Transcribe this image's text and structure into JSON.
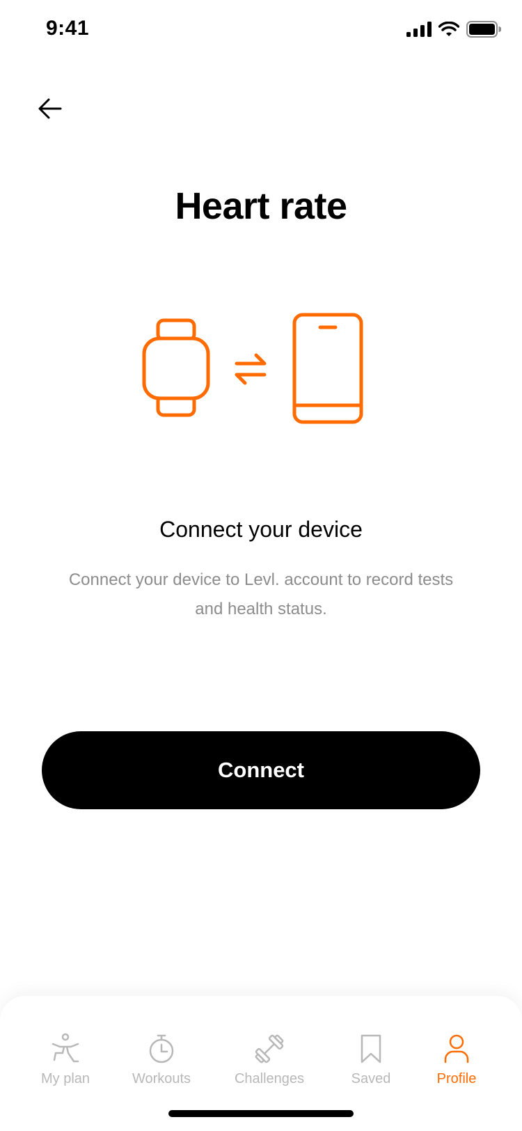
{
  "status_bar": {
    "time": "9:41"
  },
  "header": {
    "back_icon": "arrow-left-icon",
    "title": "Heart rate"
  },
  "illustration": {
    "icons": [
      "smartwatch-icon",
      "swap-arrows-icon",
      "smartphone-icon"
    ],
    "accent_color": "#FF6B00"
  },
  "content": {
    "heading": "Connect your device",
    "body": "Connect your device to Levl. account to record tests and health status."
  },
  "primary_action": {
    "label": "Connect"
  },
  "tab_bar": {
    "active_color": "#FF6B00",
    "inactive_color": "#B8B8B8",
    "items": [
      {
        "label": "My plan",
        "icon": "yoga-person-icon",
        "active": false
      },
      {
        "label": "Workouts",
        "icon": "stopwatch-icon",
        "active": false
      },
      {
        "label": "Challenges",
        "icon": "dumbbell-icon",
        "active": false
      },
      {
        "label": "Saved",
        "icon": "bookmark-icon",
        "active": false
      },
      {
        "label": "Profile",
        "icon": "person-icon",
        "active": true
      }
    ]
  }
}
